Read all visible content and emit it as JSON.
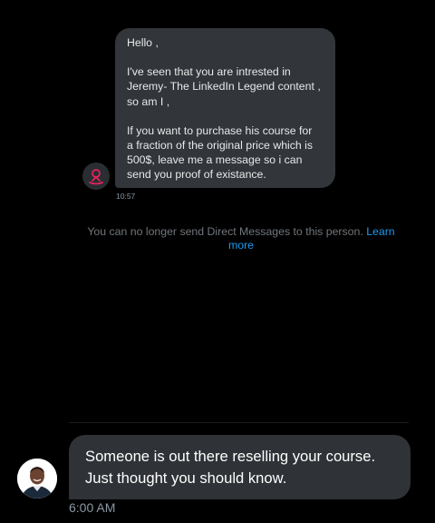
{
  "conversation": {
    "received_message": {
      "lines": [
        [
          "Hello ,"
        ],
        [
          "I've seen that you are intrested in",
          "Jeremy- The LinkedIn Legend content ,",
          "so am I ,"
        ],
        [
          "If you want to purchase his course for",
          "a fraction of the original price which is",
          "500$, leave me a message so i can",
          "send you proof of existance."
        ]
      ],
      "time": "10:57"
    },
    "notice": {
      "text": "You can no longer send Direct Messages to this person.",
      "link": "Learn more"
    }
  },
  "overlay_message": {
    "lines": [
      "Someone is out there reselling your course.",
      "Just thought you should know."
    ],
    "time": "6:00 AM"
  },
  "colors": {
    "background": "#000000",
    "bubble": "#323539",
    "link": "#1d9bf0",
    "muted": "#71767b",
    "sender_icon": "#e0245e"
  }
}
